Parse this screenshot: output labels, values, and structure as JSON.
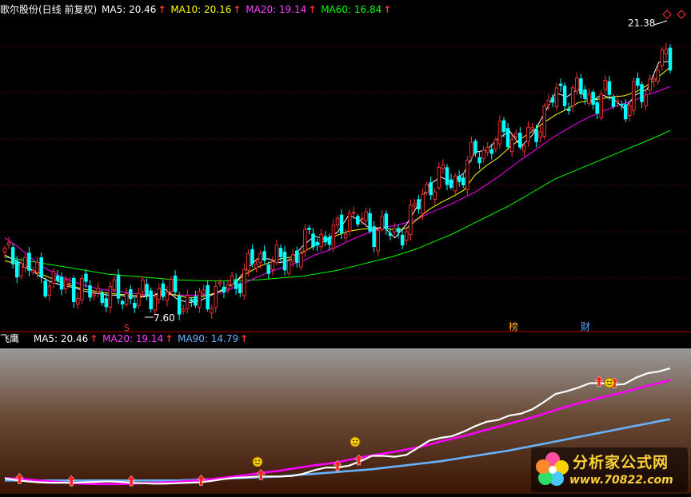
{
  "main_header": {
    "name": "歌尔股份(日线 前复权)",
    "ma5": "MA5: 20.46",
    "ma10": "MA10: 20.16",
    "ma20": "MA20: 19.14",
    "ma60": "MA60: 16.84",
    "arrow": "↑"
  },
  "sub_header": {
    "name": "飞鹰",
    "ma5": "MA5: 20.46",
    "ma20": "MA20: 19.14",
    "ma90": "MA90: 14.79",
    "arrow": "↑"
  },
  "labels": {
    "high": "21.38",
    "low": "7.60",
    "event_s": "S",
    "event_bang": "榜",
    "event_cai": "财"
  },
  "watermark": {
    "title": "分析家公式网",
    "url": "www.70822.com"
  },
  "colors": {
    "up": "#ff3232",
    "down": "#00ffff",
    "ma5": "#ffffff",
    "ma10": "#ffff00",
    "ma20": "#ff00ff",
    "ma60": "#00ff00",
    "ma90": "#66b2ff",
    "grid": "#8b0000"
  },
  "chart_data": [
    {
      "type": "candlestick",
      "title": "歌尔股份(日线 前复权)",
      "ylim": [
        7.0,
        22.5
      ],
      "annotated_high": 21.38,
      "annotated_low": 7.6,
      "series": [
        {
          "name": "MA5",
          "values": [
            10.3,
            10.0,
            9.7,
            9.2,
            8.9,
            8.7,
            8.6,
            8.4,
            8.3,
            8.2,
            8.2,
            8.1,
            8.1,
            8.2,
            8.5,
            8.0,
            7.8,
            7.9,
            8.2,
            8.5,
            8.8,
            9.5,
            10.1,
            10.1,
            9.9,
            10.1,
            10.8,
            11.3,
            11.1,
            11.5,
            12.4,
            12.1,
            11.6,
            11.8,
            11.2,
            11.9,
            12.9,
            14.0,
            14.4,
            14.1,
            14.6,
            15.7,
            15.8,
            16.4,
            16.8,
            16.0,
            16.6,
            17.7,
            18.8,
            18.6,
            19.0,
            18.3,
            18.7,
            18.5,
            18.0,
            18.7,
            19.0,
            20.4,
            20.46
          ]
        },
        {
          "name": "MA10",
          "values": [
            10.0,
            9.85,
            9.6,
            9.35,
            9.1,
            8.85,
            8.65,
            8.5,
            8.4,
            8.3,
            8.25,
            8.2,
            8.15,
            8.2,
            8.3,
            8.2,
            8.05,
            8.1,
            8.25,
            8.45,
            8.85,
            9.3,
            9.65,
            9.9,
            10.1,
            10.2,
            10.45,
            10.8,
            11.05,
            11.35,
            11.55,
            11.65,
            11.7,
            11.75,
            11.6,
            11.7,
            12.2,
            12.7,
            13.05,
            13.35,
            13.7,
            14.5,
            15.0,
            15.4,
            15.95,
            16.4,
            16.8,
            17.25,
            17.65,
            17.95,
            18.3,
            18.4,
            18.5,
            18.6,
            18.65,
            18.85,
            19.2,
            19.65,
            20.16
          ]
        },
        {
          "name": "MA20",
          "values": [
            11.2,
            10.8,
            10.3,
            9.8,
            9.45,
            9.15,
            8.9,
            8.7,
            8.55,
            8.45,
            8.4,
            8.3,
            8.25,
            8.2,
            8.25,
            8.2,
            8.2,
            8.2,
            8.25,
            8.35,
            8.6,
            8.85,
            9.15,
            9.4,
            9.6,
            9.8,
            10.0,
            10.3,
            10.5,
            10.75,
            11.05,
            11.3,
            11.55,
            11.75,
            11.85,
            12.0,
            12.2,
            12.5,
            12.75,
            13.0,
            13.3,
            13.6,
            14.0,
            14.4,
            14.85,
            15.3,
            15.7,
            16.15,
            16.55,
            16.9,
            17.25,
            17.55,
            17.8,
            18.05,
            18.25,
            18.45,
            18.7,
            18.9,
            19.14
          ]
        },
        {
          "name": "MA60",
          "values": [
            10.2,
            10.1,
            10.0,
            9.9,
            9.8,
            9.7,
            9.6,
            9.5,
            9.4,
            9.3,
            9.25,
            9.2,
            9.15,
            9.1,
            9.05,
            9.0,
            8.98,
            8.96,
            8.95,
            8.95,
            8.96,
            8.98,
            9.0,
            9.05,
            9.1,
            9.15,
            9.2,
            9.3,
            9.4,
            9.5,
            9.65,
            9.8,
            9.95,
            10.1,
            10.25,
            10.45,
            10.65,
            10.9,
            11.15,
            11.4,
            11.7,
            12.0,
            12.3,
            12.6,
            12.9,
            13.25,
            13.6,
            13.95,
            14.3,
            14.55,
            14.8,
            15.05,
            15.3,
            15.55,
            15.8,
            16.05,
            16.3,
            16.55,
            16.84
          ]
        }
      ]
    },
    {
      "type": "line",
      "title": "飞鹰",
      "ylim": [
        7.0,
        22.5
      ],
      "series": [
        {
          "name": "MA5",
          "values": [
            8.2,
            8.0,
            7.85,
            7.75,
            7.7,
            7.7,
            7.7,
            7.75,
            7.8,
            7.85,
            7.8,
            7.7,
            7.65,
            7.6,
            7.6,
            7.65,
            7.7,
            7.75,
            7.9,
            8.1,
            8.25,
            8.3,
            8.4,
            8.4,
            8.4,
            8.45,
            8.7,
            9.1,
            9.4,
            9.4,
            9.6,
            10.1,
            10.7,
            10.7,
            10.6,
            10.8,
            11.6,
            12.4,
            12.7,
            12.9,
            13.4,
            14.0,
            14.5,
            14.7,
            15.2,
            15.4,
            15.9,
            16.7,
            17.6,
            17.9,
            18.3,
            18.8,
            18.8,
            18.6,
            18.7,
            19.4,
            19.9,
            20.1,
            20.46
          ]
        },
        {
          "name": "MA20",
          "values": [
            8.2,
            8.15,
            8.05,
            7.95,
            7.85,
            7.75,
            7.65,
            7.6,
            7.55,
            7.55,
            7.55,
            7.6,
            7.65,
            7.7,
            7.75,
            7.8,
            7.9,
            8.0,
            8.1,
            8.25,
            8.4,
            8.55,
            8.75,
            8.9,
            9.05,
            9.25,
            9.45,
            9.65,
            9.8,
            10.0,
            10.25,
            10.5,
            10.75,
            10.95,
            11.15,
            11.4,
            11.65,
            11.95,
            12.3,
            12.6,
            12.9,
            13.25,
            13.6,
            13.95,
            14.3,
            14.65,
            15.0,
            15.4,
            15.8,
            16.2,
            16.55,
            16.9,
            17.2,
            17.5,
            17.8,
            18.15,
            18.5,
            18.8,
            19.14
          ]
        },
        {
          "name": "MA90",
          "values": [
            7.95,
            7.95,
            7.95,
            7.95,
            7.95,
            7.95,
            7.95,
            7.95,
            7.95,
            7.95,
            7.95,
            7.95,
            7.95,
            7.95,
            7.95,
            7.95,
            8.0,
            8.05,
            8.1,
            8.15,
            8.2,
            8.25,
            8.3,
            8.35,
            8.4,
            8.5,
            8.6,
            8.7,
            8.8,
            8.9,
            9.0,
            9.1,
            9.2,
            9.35,
            9.5,
            9.65,
            9.8,
            9.95,
            10.1,
            10.3,
            10.5,
            10.7,
            10.9,
            11.1,
            11.3,
            11.55,
            11.8,
            12.05,
            12.3,
            12.55,
            12.8,
            13.05,
            13.3,
            13.55,
            13.8,
            14.05,
            14.3,
            14.55,
            14.79
          ]
        }
      ]
    }
  ]
}
